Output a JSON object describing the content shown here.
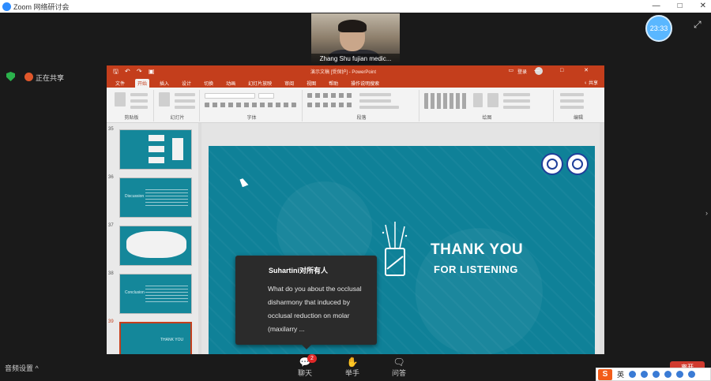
{
  "window": {
    "title": "Zoom 网络研讨会",
    "controls": [
      "—",
      "□",
      "✕"
    ]
  },
  "video": {
    "participant_name": "Zhang Shu fujian medic..."
  },
  "timer": {
    "text": "23:33"
  },
  "share_bar": {
    "label": "正在共享"
  },
  "ppt": {
    "title_bar": {
      "quick_access": "🖫 ↶ ↷ ▣",
      "document": "演示文稿 [受保护] - PowerPoint",
      "user": "登录",
      "window_controls": "▭ — □ ✕"
    },
    "tabs": [
      "文件",
      "开始",
      "插入",
      "设计",
      "切换",
      "动画",
      "幻灯片放映",
      "审阅",
      "视图",
      "帮助",
      "操作说明搜索"
    ],
    "active_tab": "开始",
    "share_label": "♀ 共享",
    "ribbon_groups": [
      "剪贴板",
      "幻灯片",
      "字体",
      "段落",
      "绘图",
      "编辑"
    ]
  },
  "thumbnails": [
    {
      "number": "35",
      "title": ""
    },
    {
      "number": "36",
      "title": "Discussion"
    },
    {
      "number": "37",
      "title": ""
    },
    {
      "number": "38",
      "title": "Conclusion"
    },
    {
      "number": "39",
      "title": "THANK YOU"
    }
  ],
  "slide": {
    "line1": "THANK YOU",
    "line2": "FOR LISTENING"
  },
  "chat_popup": {
    "sender": "Suhartini对所有人",
    "message": "What do you about the occlusal disharmony that induced by occlusal reduction on molar (maxilarry ..."
  },
  "bottom_bar": {
    "audio_label": "音频设置 ^",
    "chat_badge": "2",
    "buttons": [
      {
        "label": "聊天",
        "icon": "💬"
      },
      {
        "label": "举手",
        "icon": "✋"
      },
      {
        "label": "问答",
        "icon": "🗨"
      }
    ],
    "end_label": "离开"
  },
  "ime": {
    "logo": "S",
    "lang": "英"
  }
}
